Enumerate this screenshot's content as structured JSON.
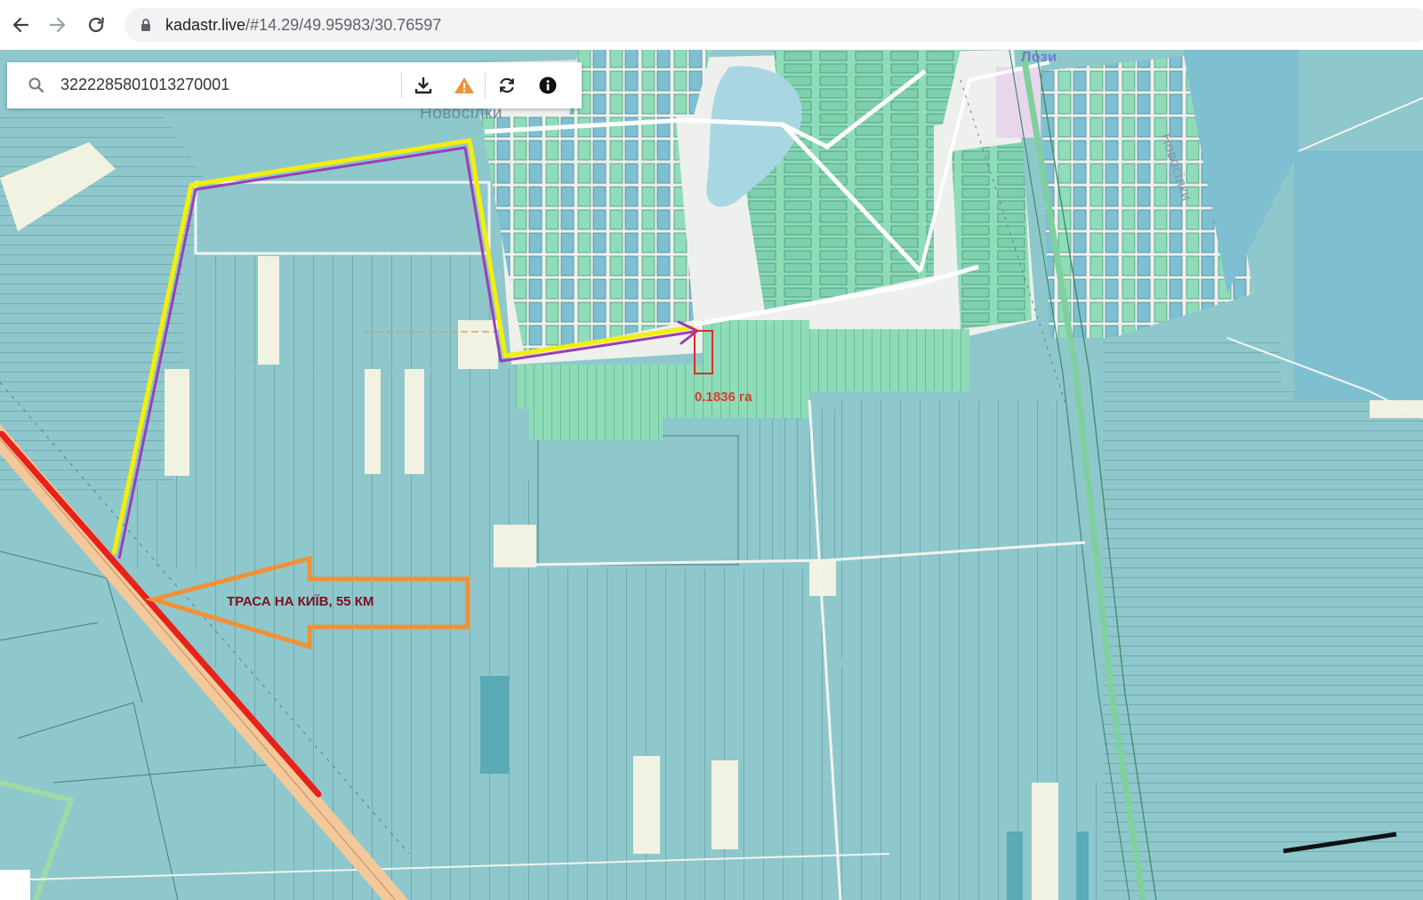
{
  "browser": {
    "url_host": "kadastr.live",
    "url_path": "/#14.29/49.95983/30.76597",
    "back_icon": "arrow-left-icon",
    "forward_icon": "arrow-right-icon",
    "reload_icon": "reload-icon",
    "lock_icon": "lock-icon"
  },
  "search": {
    "value": "3222285801013270001",
    "icon": "search-icon"
  },
  "toolbar": {
    "download_icon": "download-icon",
    "warning_icon": "warning-icon",
    "refresh_icon": "refresh-icon",
    "info_icon": "info-icon"
  },
  "map": {
    "labels": {
      "novosilky_top": "Новосілки",
      "lozy": "Лози",
      "novosilky_right": "Новосілки"
    },
    "annotations": {
      "parcel_area": "0.1836 га",
      "route_text": "ТРАСА НА КИЇВ,  55 КМ"
    },
    "colors": {
      "field": "#8ec8cc",
      "field_dark": "#68b4c0",
      "residential": "#8fdcb8",
      "road": "#f2f2ee",
      "water": "#a9d6e3",
      "highway": "#f3c89a",
      "yellow_route": "#f5ee0a",
      "purple_route": "#9b3fb5",
      "red_highway_mark": "#e8211b",
      "orange_arrow": "#f39036",
      "parcel_outline": "#e02a2a"
    }
  }
}
